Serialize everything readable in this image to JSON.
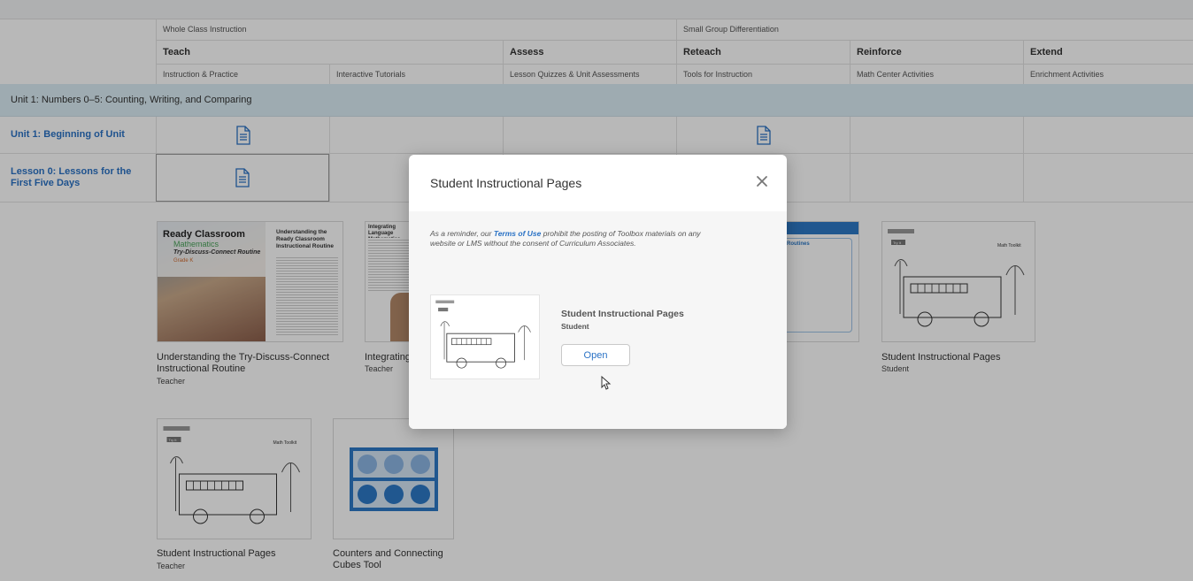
{
  "grid": {
    "groups": [
      "Whole Class Instruction",
      "Small Group Differentiation"
    ],
    "categories": [
      "Teach",
      "Assess",
      "Reteach",
      "Reinforce",
      "Extend"
    ],
    "subcategories": [
      "Instruction & Practice",
      "Interactive Tutorials",
      "Lesson Quizzes & Unit Assessments",
      "Tools for Instruction",
      "Math Center Activities",
      "Enrichment Activities"
    ],
    "unit_banner": "Unit 1: Numbers 0–5: Counting, Writing, and Comparing",
    "rows": [
      {
        "label": "Unit 1: Beginning of Unit"
      },
      {
        "label": "Lesson 0: Lessons for the First Five Days"
      }
    ]
  },
  "cards": [
    {
      "title": "Understanding the Try-Discuss-Connect Instructional Routine",
      "audience": "Teacher",
      "thumb": {
        "brand": "Ready Classroom",
        "subject": "Mathematics",
        "routine": "Try-Discuss-Connect Routine",
        "grade": "Grade K",
        "heading": "Understanding the Ready Classroom Instructional Routine"
      }
    },
    {
      "title": "Integrating",
      "audience": "Teacher",
      "thumb": {
        "heading": "Integrating Language Mathematics"
      }
    },
    {
      "title": "",
      "audience": "",
      "thumb": {
        "heading": "Routines"
      }
    },
    {
      "title": "Student Instructional Pages",
      "audience": "Student",
      "thumb": {
        "tag": "Try It",
        "brand": "Math Toolkit"
      }
    },
    {
      "title": "Student Instructional Pages",
      "audience": "Teacher",
      "thumb": {
        "tag": "Try It",
        "brand": "Math Toolkit"
      }
    },
    {
      "title": "Counters and Connecting Cubes Tool",
      "audience": "",
      "thumb": {}
    }
  ],
  "modal": {
    "title": "Student Instructional Pages",
    "reminder_prefix": "As a reminder, our ",
    "reminder_link": "Terms of Use",
    "reminder_suffix": " prohibit the posting of Toolbox materials on any website or LMS without the consent of Curriculum Associates.",
    "item_title": "Student Instructional Pages",
    "item_audience": "Student",
    "open_label": "Open",
    "close_icon": "close-icon"
  },
  "colors": {
    "link": "#2a72c5",
    "banner": "#dceef5",
    "tool_blue": "#2d79c7"
  }
}
